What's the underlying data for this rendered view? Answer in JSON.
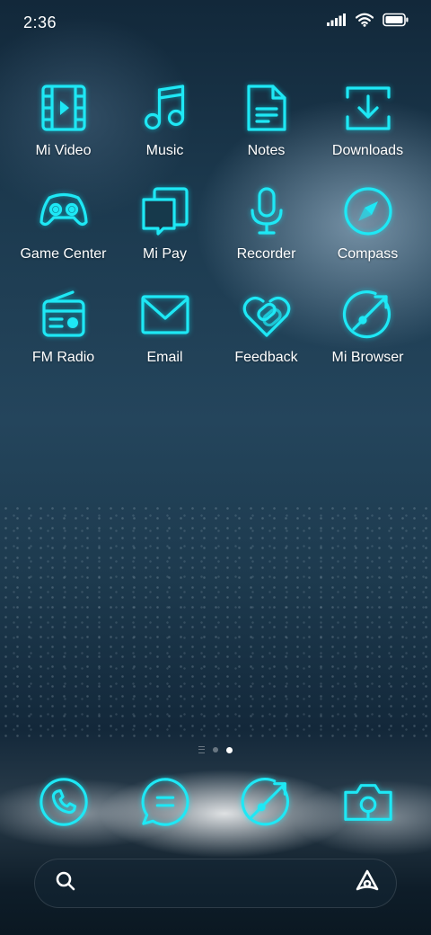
{
  "status_bar": {
    "time": "2:36",
    "icons": [
      "signal-icon",
      "wifi-icon",
      "battery-icon"
    ]
  },
  "theme": {
    "accent": "#1ee8f5",
    "icon_glow": "#00f0ff"
  },
  "apps": [
    {
      "label": "Mi Video",
      "icon": "video-icon"
    },
    {
      "label": "Music",
      "icon": "music-note-icon"
    },
    {
      "label": "Notes",
      "icon": "notes-icon"
    },
    {
      "label": "Downloads",
      "icon": "download-icon"
    },
    {
      "label": "Game Center",
      "icon": "gamepad-icon"
    },
    {
      "label": "Mi Pay",
      "icon": "cards-icon"
    },
    {
      "label": "Recorder",
      "icon": "microphone-icon"
    },
    {
      "label": "Compass",
      "icon": "compass-icon"
    },
    {
      "label": "FM Radio",
      "icon": "radio-icon"
    },
    {
      "label": "Email",
      "icon": "envelope-icon"
    },
    {
      "label": "Feedback",
      "icon": "heart-link-icon"
    },
    {
      "label": "Mi Browser",
      "icon": "browser-icon"
    }
  ],
  "page_indicator": {
    "pages": 3,
    "current": 3
  },
  "dock": [
    {
      "icon": "phone-icon"
    },
    {
      "icon": "message-icon"
    },
    {
      "icon": "browser-icon"
    },
    {
      "icon": "camera-icon"
    }
  ],
  "search": {
    "placeholder": "",
    "left_icon": "search-icon",
    "right_icon": "assistant-icon"
  }
}
